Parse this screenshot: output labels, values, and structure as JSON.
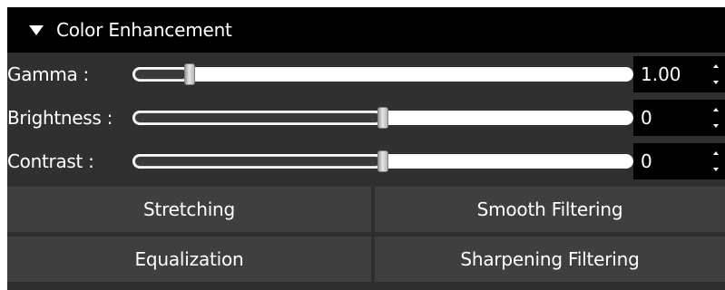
{
  "panel": {
    "title": "Color Enhancement",
    "collapse_icon": "caret-down-icon"
  },
  "sliders": [
    {
      "label": "Gamma :",
      "value": "1.00",
      "position": 0.1
    },
    {
      "label": "Brightness :",
      "value": "0",
      "position": 0.5
    },
    {
      "label": "Contrast :",
      "value": "0",
      "position": 0.5
    }
  ],
  "spin_icons": {
    "up": "spin-up-icon",
    "down": "spin-down-icon"
  },
  "buttons": {
    "stretching": "Stretching",
    "smooth_filtering": "Smooth Filtering",
    "equalization": "Equalization",
    "sharpening_filtering": "Sharpening Filtering"
  },
  "colors": {
    "header_bg": "#000000",
    "panel_bg": "#303030",
    "button_bg": "#3f3f3f",
    "text": "#ffffff"
  }
}
